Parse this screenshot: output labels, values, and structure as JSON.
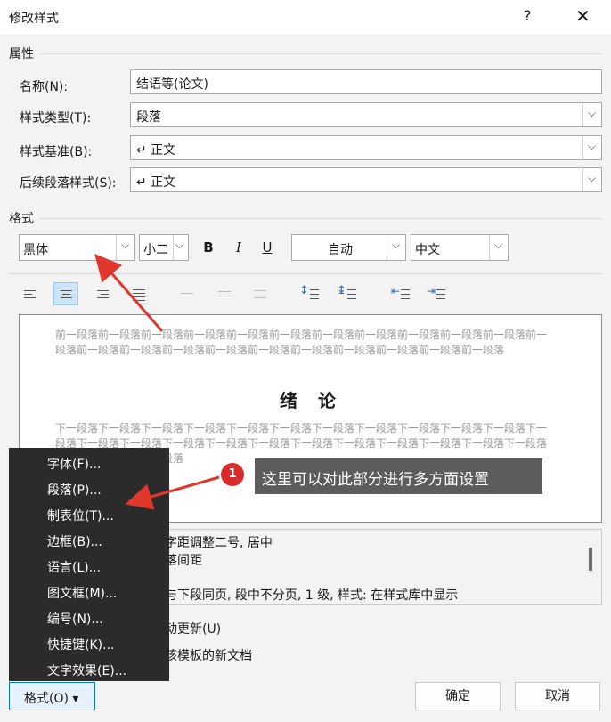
{
  "dialog": {
    "title": "修改样式",
    "help": "?",
    "close": "✕"
  },
  "properties": {
    "section_label": "属性",
    "name_label": "名称(N):",
    "name_value": "结语等(论文)",
    "type_label": "样式类型(T):",
    "type_value": "段落",
    "based_label": "样式基准(B):",
    "based_value": "↵ 正文",
    "next_label": "后续段落样式(S):",
    "next_value": "↵ 正文"
  },
  "format": {
    "section_label": "格式",
    "font": "黑体",
    "size": "小二",
    "bold": "B",
    "italic": "I",
    "underline": "U",
    "color": "自动",
    "script": "中文"
  },
  "preview": {
    "prev_para": "前一段落前一段落前一段落前一段落前一段落前一段落前一段落前一段落前一段落前一段落前一段落前一段落前一段落前一段落前一段落前一段落前一段落前一段落前一段落前一段落前一段落前一段落",
    "title": "绪 论",
    "next_para": "下一段落下一段落下一段落下一段落下一段落下一段落下一段落下一段落下一段落下一段落下一段落下一段落下一段落下一段落下一段落下一段落下一段落下一段落下一段落下一段落下一段落下一段落下一段落下一段落下一段落下一段落"
  },
  "description": {
    "line1": "字距调整二号, 居中",
    "line2": "落间距",
    "line3": "与下段同页, 段中不分页, 1 级, 样式: 在样式库中显示"
  },
  "options": {
    "auto_update": "动更新(U)",
    "template": "该模板的新文档"
  },
  "menu": {
    "items": [
      "字体(F)...",
      "段落(P)...",
      "制表位(T)...",
      "边框(B)...",
      "语言(L)...",
      "图文框(M)...",
      "编号(N)...",
      "快捷键(K)...",
      "文字效果(E)..."
    ]
  },
  "buttons": {
    "format": "格式(O) ▾",
    "ok": "确定",
    "cancel": "取消"
  },
  "annotation": {
    "badge": "1",
    "text": "这里可以对此部分进行多方面设置"
  }
}
